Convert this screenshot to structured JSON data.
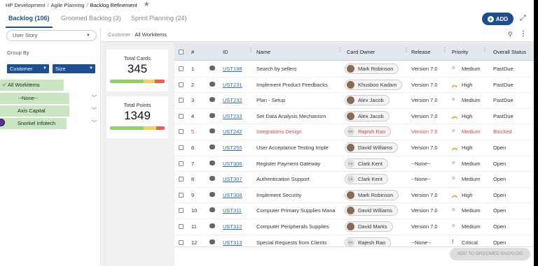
{
  "breadcrumb": {
    "items": [
      "HP Development",
      "Agile Planning",
      "Backlog Refinement"
    ]
  },
  "tabs": [
    {
      "label": "Backlog (106)",
      "active": true
    },
    {
      "label": "Groomed Backlog (3)",
      "active": false
    },
    {
      "label": "Sprint Planning (24)",
      "active": false
    }
  ],
  "add_button": {
    "label": "ADD"
  },
  "sidebar": {
    "story_select": "User Story",
    "group_by_label": "Group By",
    "group_by": [
      "Customer",
      "Size"
    ],
    "tree": [
      {
        "label": "All Workitems",
        "selected": true
      },
      {
        "label": "--None--"
      },
      {
        "label": "Axis Capital"
      },
      {
        "label": "Snorkel Infotech"
      }
    ]
  },
  "filter": {
    "prefix": "Customer :",
    "value": "All Workitems"
  },
  "cards": [
    {
      "title": "Total Cards",
      "value": "345"
    },
    {
      "title": "Total Points",
      "value": "1349"
    }
  ],
  "table": {
    "columns": [
      "#",
      "ID",
      "Name",
      "Card Owner",
      "Release",
      "Priority",
      "Overall Status"
    ],
    "rows": [
      {
        "num": "1",
        "id": "UST198",
        "name": "Search by sellers",
        "owner": "Mark Robinson",
        "owner_avatar": "photo",
        "release": "Version 7.0",
        "priority": "Medium",
        "prio_icon": "=",
        "status": "PastDue"
      },
      {
        "num": "2",
        "id": "UST231",
        "name": "Implement Product Feedbacks",
        "owner": "Khusboo Kadam",
        "owner_avatar": "photo",
        "release": "Version 7.0",
        "priority": "High",
        "prio_icon": "^",
        "status": "PastDue"
      },
      {
        "num": "3",
        "id": "UST232",
        "name": "Plan - Setup",
        "owner": "Alex Jacob",
        "owner_avatar": "photo",
        "release": "Version 7.0",
        "priority": "Medium",
        "prio_icon": "=",
        "status": "PastDue"
      },
      {
        "num": "4",
        "id": "UST233",
        "name": "Set Data Analysis Mechanism",
        "owner": "Alex Jacob",
        "owner_avatar": "photo",
        "release": "Version 7.0",
        "priority": "High",
        "prio_icon": "^",
        "status": "PastDue"
      },
      {
        "num": "5",
        "id": "UST242",
        "name": "Integrations Design",
        "owner": "Rajesh Rao",
        "owner_avatar": "RR",
        "release": "Version 7.0",
        "priority": "Medium",
        "prio_icon": "=",
        "status": "Blocked",
        "blocked": true
      },
      {
        "num": "6",
        "id": "UST255",
        "name": "User Acceptance Testing Imple",
        "owner": "David Williams",
        "owner_avatar": "photo",
        "release": "Version 7.0",
        "priority": "High",
        "prio_icon": "^",
        "status": "Open"
      },
      {
        "num": "7",
        "id": "UST306",
        "name": "Register Payment Gateway",
        "owner": "Clark Kent",
        "owner_avatar": "CK",
        "release": "--None--",
        "priority": "Medium",
        "prio_icon": "=",
        "status": "Open"
      },
      {
        "num": "8",
        "id": "UST307",
        "name": "Authentication Support",
        "owner": "Clark Kent",
        "owner_avatar": "CK",
        "release": "--None--",
        "priority": "Medium",
        "prio_icon": "=",
        "status": "Open"
      },
      {
        "num": "9",
        "id": "UST308",
        "name": "Implement Security",
        "owner": "Mark Robinson",
        "owner_avatar": "photo",
        "release": "Version 7.0",
        "priority": "High",
        "prio_icon": "^",
        "status": "Open"
      },
      {
        "num": "10",
        "id": "UST311",
        "name": "Computer Primary Supplies Mana",
        "owner": "David Williams",
        "owner_avatar": "photo",
        "release": "Version 7.0",
        "priority": "Medium",
        "prio_icon": "=",
        "status": "Open"
      },
      {
        "num": "11",
        "id": "UST312",
        "name": "Computer Peripherals Supplies",
        "owner": "David Marks",
        "owner_avatar": "photo",
        "release": "Version 7.0",
        "priority": "Medium",
        "prio_icon": "=",
        "status": "Open"
      },
      {
        "num": "12",
        "id": "UST313",
        "name": "Special Requests from Clients",
        "owner": "Rajesh Rao",
        "owner_avatar": "RR",
        "release": "--None--",
        "priority": "Critical",
        "prio_icon": "!",
        "status": "Open"
      }
    ]
  },
  "footer": {
    "groom_button": "ADD TO GROOMED BACKLOG"
  },
  "colors": {
    "accent": "#1c4f8f",
    "tree_highlight": "#c8e6c0",
    "blocked": "#e04848",
    "link": "#2d6fb7"
  }
}
